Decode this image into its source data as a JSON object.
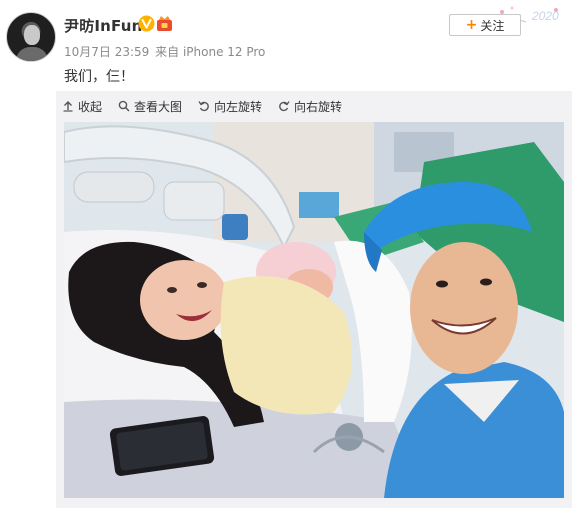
{
  "post": {
    "author": "尹昉InFun",
    "timestamp": "10月7日 23:59",
    "source": "来自 iPhone 12 Pro",
    "text": "我们，仨！"
  },
  "follow_button": {
    "label": "关注",
    "icon": "plus-icon"
  },
  "corner_decoration_text": "2020",
  "toolbar": {
    "collapse": {
      "label": "收起",
      "icon": "arrow-up-icon"
    },
    "view_large": {
      "label": "查看大图",
      "icon": "magnifier-icon"
    },
    "rotate_left": {
      "label": "向左旋转",
      "icon": "rotate-left-icon"
    },
    "rotate_right": {
      "label": "向右旋转",
      "icon": "rotate-right-icon"
    }
  },
  "icons": {
    "avatar": "avatar-icon",
    "verified": "verified-badge-icon",
    "vip": "vip-badge-icon"
  },
  "colors": {
    "accent": "#ff8200",
    "verify_badge": "#ffb300",
    "vip_badge": "#e94c2f",
    "panel_bg": "#f2f2f5",
    "surgical_blue": "#2b8fe0",
    "gown_blue": "#3a8fd6"
  }
}
